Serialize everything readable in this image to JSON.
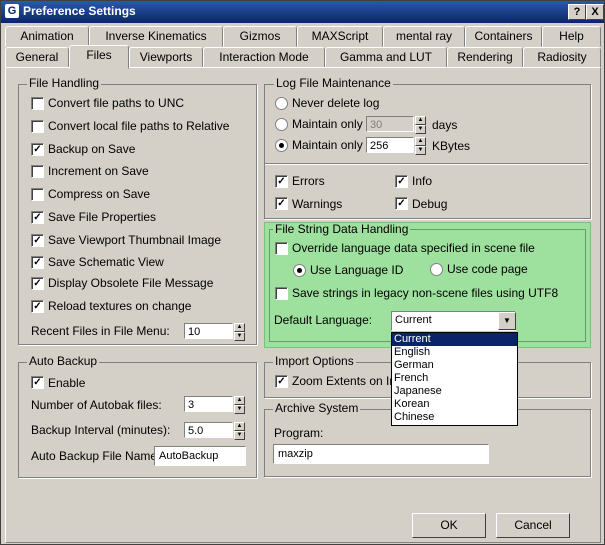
{
  "window": {
    "title": "Preference Settings",
    "help_button": "?",
    "close_button": "X"
  },
  "tabs_row1": [
    "Animation",
    "Inverse Kinematics",
    "Gizmos",
    "MAXScript",
    "mental ray",
    "Containers",
    "Help"
  ],
  "tabs_row2": [
    "General",
    "Files",
    "Viewports",
    "Interaction Mode",
    "Gamma and LUT",
    "Rendering",
    "Radiosity"
  ],
  "active_tab": "Files",
  "file_handling": {
    "title": "File Handling",
    "options": [
      {
        "label": "Convert file paths to UNC",
        "checked": false
      },
      {
        "label": "Convert local file paths to Relative",
        "checked": false
      },
      {
        "label": "Backup on Save",
        "checked": true
      },
      {
        "label": "Increment on Save",
        "checked": false
      },
      {
        "label": "Compress on Save",
        "checked": false
      },
      {
        "label": "Save File Properties",
        "checked": true
      },
      {
        "label": "Save Viewport Thumbnail Image",
        "checked": true
      },
      {
        "label": "Save Schematic View",
        "checked": true
      },
      {
        "label": "Display Obsolete File Message",
        "checked": true
      },
      {
        "label": "Reload textures on change",
        "checked": true
      }
    ],
    "recent_files_label": "Recent Files in File Menu:",
    "recent_files_value": "10"
  },
  "auto_backup": {
    "title": "Auto Backup",
    "enable_label": "Enable",
    "enable_checked": true,
    "num_files_label": "Number of Autobak files:",
    "num_files_value": "3",
    "interval_label": "Backup Interval (minutes):",
    "interval_value": "5.0",
    "filename_label": "Auto Backup File Name:",
    "filename_value": "AutoBackup"
  },
  "log_file": {
    "title": "Log File Maintenance",
    "never_delete": "Never delete log",
    "maintain_only_1": "Maintain only",
    "days_value": "30",
    "days_unit": "days",
    "maintain_only_2": "Maintain only",
    "kb_value": "256",
    "kb_unit": "KBytes",
    "selected_option": 2,
    "errors": "Errors",
    "info": "Info",
    "warnings": "Warnings",
    "debug": "Debug"
  },
  "file_string": {
    "title": "File String Data Handling",
    "override_label": "Override language data specified in scene file",
    "use_language_id": "Use Language ID",
    "use_code_page": "Use code page",
    "legacy_label": "Save strings in legacy non-scene files using UTF8",
    "default_language_label": "Default Language:",
    "default_language_value": "Current",
    "dropdown_options": [
      "Current",
      "English",
      "German",
      "French",
      "Japanese",
      "Korean",
      "Chinese"
    ]
  },
  "import_options": {
    "title": "Import Options",
    "zoom_extents_label": "Zoom Extents on Import"
  },
  "archive": {
    "title": "Archive System",
    "program_label": "Program:",
    "program_value": "maxzip"
  },
  "buttons": {
    "ok": "OK",
    "cancel": "Cancel"
  },
  "colors": {
    "titlebar": "#0a246a",
    "highlight": "#9ee09e",
    "dialog_bg": "#d4d0c8"
  }
}
